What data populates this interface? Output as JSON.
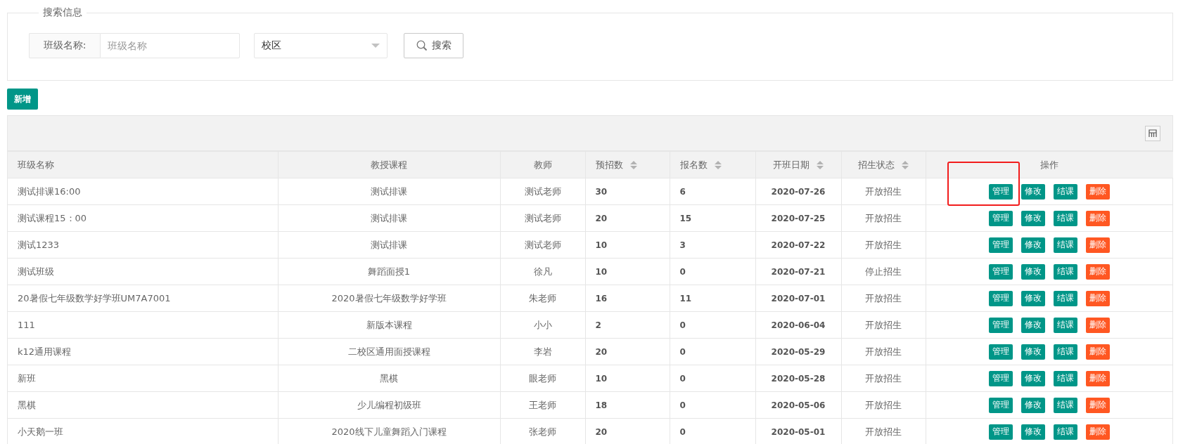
{
  "search_panel": {
    "legend": "搜索信息",
    "class_name_field": {
      "label": "班级名称:",
      "placeholder": "班级名称"
    },
    "campus_select": {
      "value": "校区"
    },
    "search_button": "搜索"
  },
  "add_button": "新增",
  "table": {
    "columns": [
      {
        "label": "班级名称",
        "sortable": false
      },
      {
        "label": "教授课程",
        "sortable": false
      },
      {
        "label": "教师",
        "sortable": false
      },
      {
        "label": "预招数",
        "sortable": true
      },
      {
        "label": "报名数",
        "sortable": true
      },
      {
        "label": "开班日期",
        "sortable": true
      },
      {
        "label": "招生状态",
        "sortable": true
      },
      {
        "label": "操作",
        "sortable": false
      }
    ],
    "rows": [
      {
        "cells": [
          "测试排课16:00",
          "测试排课",
          "测试老师",
          "30",
          "6",
          "2020-07-26",
          "开放招生"
        ],
        "actions": [
          {
            "label": "管理",
            "kind": "primary"
          },
          {
            "label": "修改",
            "kind": "primary"
          },
          {
            "label": "结课",
            "kind": "primary"
          },
          {
            "label": "删除",
            "kind": "danger"
          }
        ]
      },
      {
        "cells": [
          "测试课程15：00",
          "测试排课",
          "测试老师",
          "20",
          "15",
          "2020-07-25",
          "开放招生"
        ],
        "actions": [
          {
            "label": "管理",
            "kind": "primary"
          },
          {
            "label": "修改",
            "kind": "primary"
          },
          {
            "label": "结课",
            "kind": "primary"
          },
          {
            "label": "删除",
            "kind": "danger"
          }
        ]
      },
      {
        "cells": [
          "测试1233",
          "测试排课",
          "测试老师",
          "10",
          "3",
          "2020-07-22",
          "开放招生"
        ],
        "actions": [
          {
            "label": "管理",
            "kind": "primary"
          },
          {
            "label": "修改",
            "kind": "primary"
          },
          {
            "label": "结课",
            "kind": "primary"
          },
          {
            "label": "删除",
            "kind": "danger"
          }
        ]
      },
      {
        "cells": [
          "测试班级",
          "舞蹈面授1",
          "徐凡",
          "10",
          "0",
          "2020-07-21",
          "停止招生"
        ],
        "actions": [
          {
            "label": "管理",
            "kind": "primary"
          },
          {
            "label": "修改",
            "kind": "primary"
          },
          {
            "label": "结课",
            "kind": "primary"
          },
          {
            "label": "删除",
            "kind": "danger"
          }
        ]
      },
      {
        "cells": [
          "20暑假七年级数学好学班UM7A7001",
          "2020暑假七年级数学好学班",
          "朱老师",
          "16",
          "11",
          "2020-07-01",
          "开放招生"
        ],
        "actions": [
          {
            "label": "管理",
            "kind": "primary"
          },
          {
            "label": "修改",
            "kind": "primary"
          },
          {
            "label": "结课",
            "kind": "primary"
          },
          {
            "label": "删除",
            "kind": "danger"
          }
        ]
      },
      {
        "cells": [
          "111",
          "新版本课程",
          "小小",
          "2",
          "0",
          "2020-06-04",
          "开放招生"
        ],
        "actions": [
          {
            "label": "管理",
            "kind": "primary"
          },
          {
            "label": "修改",
            "kind": "primary"
          },
          {
            "label": "结课",
            "kind": "primary"
          },
          {
            "label": "删除",
            "kind": "danger"
          }
        ]
      },
      {
        "cells": [
          "k12通用课程",
          "二校区通用面授课程",
          "李岩",
          "20",
          "0",
          "2020-05-29",
          "开放招生"
        ],
        "actions": [
          {
            "label": "管理",
            "kind": "primary"
          },
          {
            "label": "修改",
            "kind": "primary"
          },
          {
            "label": "结课",
            "kind": "primary"
          },
          {
            "label": "删除",
            "kind": "danger"
          }
        ]
      },
      {
        "cells": [
          "新班",
          "黑棋",
          "眼老师",
          "10",
          "0",
          "2020-05-28",
          "开放招生"
        ],
        "actions": [
          {
            "label": "管理",
            "kind": "primary"
          },
          {
            "label": "修改",
            "kind": "primary"
          },
          {
            "label": "结课",
            "kind": "primary"
          },
          {
            "label": "删除",
            "kind": "danger"
          }
        ]
      },
      {
        "cells": [
          "黑棋",
          "少儿编程初级班",
          "王老师",
          "18",
          "0",
          "2020-05-06",
          "开放招生"
        ],
        "actions": [
          {
            "label": "管理",
            "kind": "primary"
          },
          {
            "label": "修改",
            "kind": "primary"
          },
          {
            "label": "结课",
            "kind": "primary"
          },
          {
            "label": "删除",
            "kind": "danger"
          }
        ]
      },
      {
        "cells": [
          "小天鹅一班",
          "2020线下儿童舞蹈入门课程",
          "张老师",
          "20",
          "0",
          "2020-05-01",
          "开放招生"
        ],
        "actions": [
          {
            "label": "管理",
            "kind": "primary"
          },
          {
            "label": "修改",
            "kind": "primary"
          },
          {
            "label": "结课",
            "kind": "primary"
          },
          {
            "label": "删除",
            "kind": "danger"
          }
        ]
      }
    ]
  }
}
